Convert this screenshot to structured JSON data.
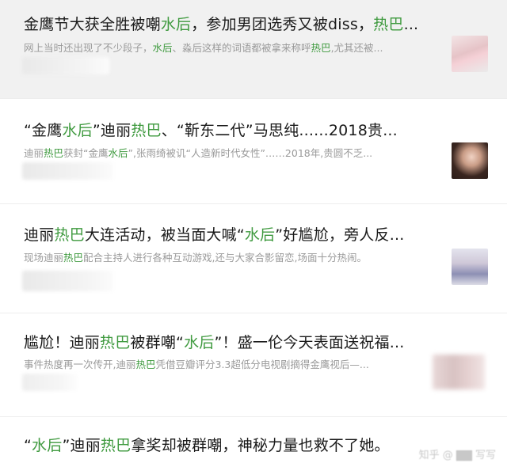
{
  "results": [
    {
      "title_parts": [
        {
          "text": "金鹰节大获全胜被嘲",
          "hl": false
        },
        {
          "text": "水后",
          "hl": true
        },
        {
          "text": "，参加男团选秀又被diss，",
          "hl": false
        },
        {
          "text": "热巴",
          "hl": true
        },
        {
          "text": "...",
          "hl": false
        }
      ],
      "snippet_parts": [
        {
          "text": "网上当时还出现了不少段子，",
          "hl": false
        },
        {
          "text": "水后",
          "hl": true
        },
        {
          "text": "、淼后这样的词语都被拿来称呼",
          "hl": false
        },
        {
          "text": "热巴",
          "hl": true
        },
        {
          "text": ",尤其还被...",
          "hl": false
        }
      ],
      "thumb_icon": "portrait-thumbnail",
      "highlighted": true
    },
    {
      "title_parts": [
        {
          "text": "“金鹰",
          "hl": false
        },
        {
          "text": "水后",
          "hl": true
        },
        {
          "text": "”迪丽",
          "hl": false
        },
        {
          "text": "热巴",
          "hl": true
        },
        {
          "text": "、“靳东二代”马思纯......2018贵...",
          "hl": false
        }
      ],
      "snippet_parts": [
        {
          "text": "迪丽",
          "hl": false
        },
        {
          "text": "热巴",
          "hl": true
        },
        {
          "text": "获封“金鹰",
          "hl": false
        },
        {
          "text": "水后",
          "hl": true
        },
        {
          "text": "”,张雨绮被讥“人造新时代女性”……2018年,贵圆不乏...",
          "hl": false
        }
      ],
      "thumb_icon": "portrait-thumbnail",
      "highlighted": false
    },
    {
      "title_parts": [
        {
          "text": "迪丽",
          "hl": false
        },
        {
          "text": "热巴",
          "hl": true
        },
        {
          "text": "大连活动，被当面大喊“",
          "hl": false
        },
        {
          "text": "水后",
          "hl": true
        },
        {
          "text": "”好尴尬，旁人反...",
          "hl": false
        }
      ],
      "snippet_parts": [
        {
          "text": "现场迪丽",
          "hl": false
        },
        {
          "text": "热巴",
          "hl": true
        },
        {
          "text": "配合主持人进行各种互动游戏,还与大家合影留恋,场面十分热闹。",
          "hl": false
        }
      ],
      "thumb_icon": "portrait-thumbnail",
      "highlighted": false
    },
    {
      "title_parts": [
        {
          "text": "尴尬！迪丽",
          "hl": false
        },
        {
          "text": "热巴",
          "hl": true
        },
        {
          "text": "被群嘲“",
          "hl": false
        },
        {
          "text": "水后",
          "hl": true
        },
        {
          "text": "”！盛一伦今天表面送祝福...",
          "hl": false
        }
      ],
      "snippet_parts": [
        {
          "text": "事件热度再一次传开,迪丽",
          "hl": false
        },
        {
          "text": "热巴",
          "hl": true
        },
        {
          "text": "凭借豆瓣评分3.3超低分电视剧摘得金鹰视后—...",
          "hl": false
        }
      ],
      "thumb_icon": "blurred-thumbnail",
      "highlighted": false
    },
    {
      "title_parts": [
        {
          "text": "“",
          "hl": false
        },
        {
          "text": "水后",
          "hl": true
        },
        {
          "text": "”迪丽",
          "hl": false
        },
        {
          "text": "热巴",
          "hl": true
        },
        {
          "text": "拿奖却被群嘲，神秘力量也救不了她。",
          "hl": false
        }
      ],
      "snippet_parts": [],
      "thumb_icon": "",
      "highlighted": false
    }
  ],
  "colors": {
    "highlight": "#3f9a3f",
    "title": "#1a1a1a",
    "snippet": "#9a9a9a",
    "selected_row_bg": "#f1f1f1"
  }
}
